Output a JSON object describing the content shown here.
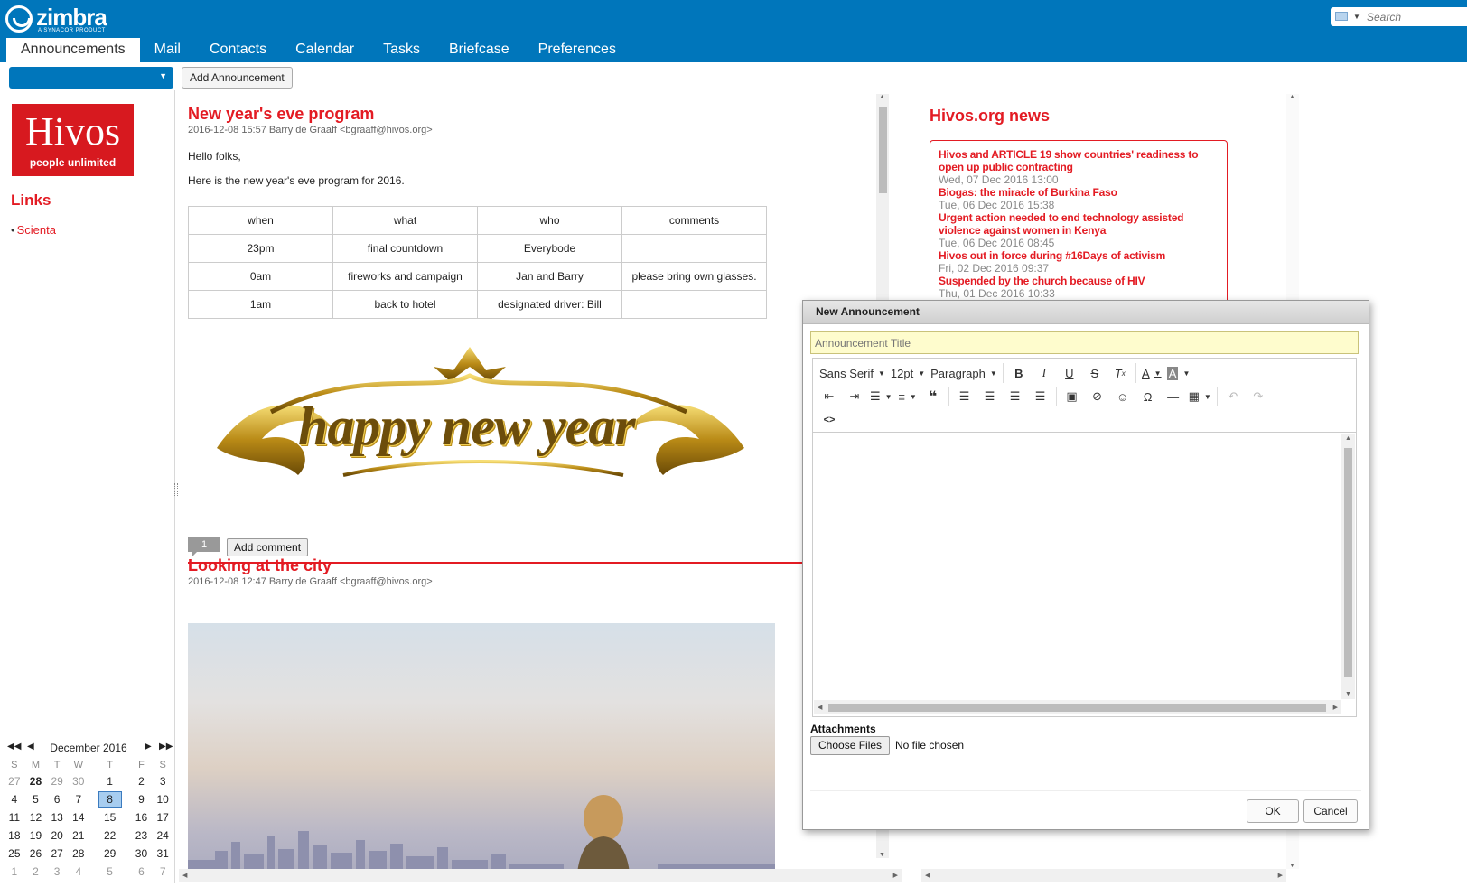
{
  "brand": {
    "name": "zimbra",
    "tagline": "A SYNACOR PRODUCT"
  },
  "search": {
    "placeholder": "Search",
    "icon": "mail-icon"
  },
  "app_tabs": [
    {
      "label": "Announcements",
      "active": true
    },
    {
      "label": "Mail"
    },
    {
      "label": "Contacts"
    },
    {
      "label": "Calendar"
    },
    {
      "label": "Tasks"
    },
    {
      "label": "Briefcase"
    },
    {
      "label": "Preferences"
    }
  ],
  "toolbar": {
    "folder_value": "",
    "add_announcement_label": "Add Announcement"
  },
  "sidebar": {
    "logo": {
      "title": "Hivos",
      "subtitle": "people unlimited"
    },
    "links_title": "Links",
    "links": [
      {
        "label": "Scienta"
      }
    ]
  },
  "mini_calendar": {
    "month_label": "December 2016",
    "weekdays": [
      "S",
      "M",
      "T",
      "W",
      "T",
      "F",
      "S"
    ],
    "weeks": [
      [
        "27",
        "28",
        "29",
        "30",
        "1",
        "2",
        "3"
      ],
      [
        "4",
        "5",
        "6",
        "7",
        "8",
        "9",
        "10"
      ],
      [
        "11",
        "12",
        "13",
        "14",
        "15",
        "16",
        "17"
      ],
      [
        "18",
        "19",
        "20",
        "21",
        "22",
        "23",
        "24"
      ],
      [
        "25",
        "26",
        "27",
        "28",
        "29",
        "30",
        "31"
      ],
      [
        "1",
        "2",
        "3",
        "4",
        "5",
        "6",
        "7"
      ]
    ],
    "today": "8"
  },
  "posts": [
    {
      "title": "New year's eve program",
      "meta": "2016-12-08 15:57 Barry de Graaff <bgraaff@hivos.org>",
      "greeting": "Hello folks,",
      "intro": "Here is the new year's eve program for 2016.",
      "table": [
        [
          "when",
          "what",
          "who",
          "comments"
        ],
        [
          "23pm",
          "final countdown",
          "Everybode",
          ""
        ],
        [
          "0am",
          "fireworks and campaign",
          "Jan and Barry",
          "please bring own glasses."
        ],
        [
          "1am",
          "back to hotel",
          "designated driver: Bill",
          ""
        ]
      ],
      "image_text": "happy new year",
      "comment_count": "1",
      "add_comment_label": "Add comment"
    },
    {
      "title": "Looking at the city",
      "meta": "2016-12-08 12:47 Barry de Graaff <bgraaff@hivos.org>"
    }
  ],
  "news": {
    "title": "Hivos.org news",
    "items": [
      {
        "title": "Hivos and ARTICLE 19 show countries' readiness to open up public contracting",
        "date": "Wed, 07 Dec 2016 13:00"
      },
      {
        "title": "Biogas: the miracle of Burkina Faso",
        "date": "Tue, 06 Dec 2016 15:38"
      },
      {
        "title": "Urgent action needed to end technology assisted violence against women in Kenya",
        "date": "Tue, 06 Dec 2016 08:45"
      },
      {
        "title": "Hivos out in force during #16Days of activism",
        "date": "Fri, 02 Dec 2016 09:37"
      },
      {
        "title": "Suspended by the church because of HIV",
        "date": "Thu, 01 Dec 2016 10:33"
      }
    ]
  },
  "dialog": {
    "title": "New Announcement",
    "title_placeholder": "Announcement Title",
    "font_family": "Sans Serif",
    "font_size": "12pt",
    "block_format": "Paragraph",
    "attachments_label": "Attachments",
    "choose_files_label": "Choose Files",
    "no_file_label": "No file chosen",
    "ok_label": "OK",
    "cancel_label": "Cancel"
  },
  "colors": {
    "header": "#0076bb",
    "accent_red": "#e31b23",
    "title_field_bg": "#fefccd"
  }
}
